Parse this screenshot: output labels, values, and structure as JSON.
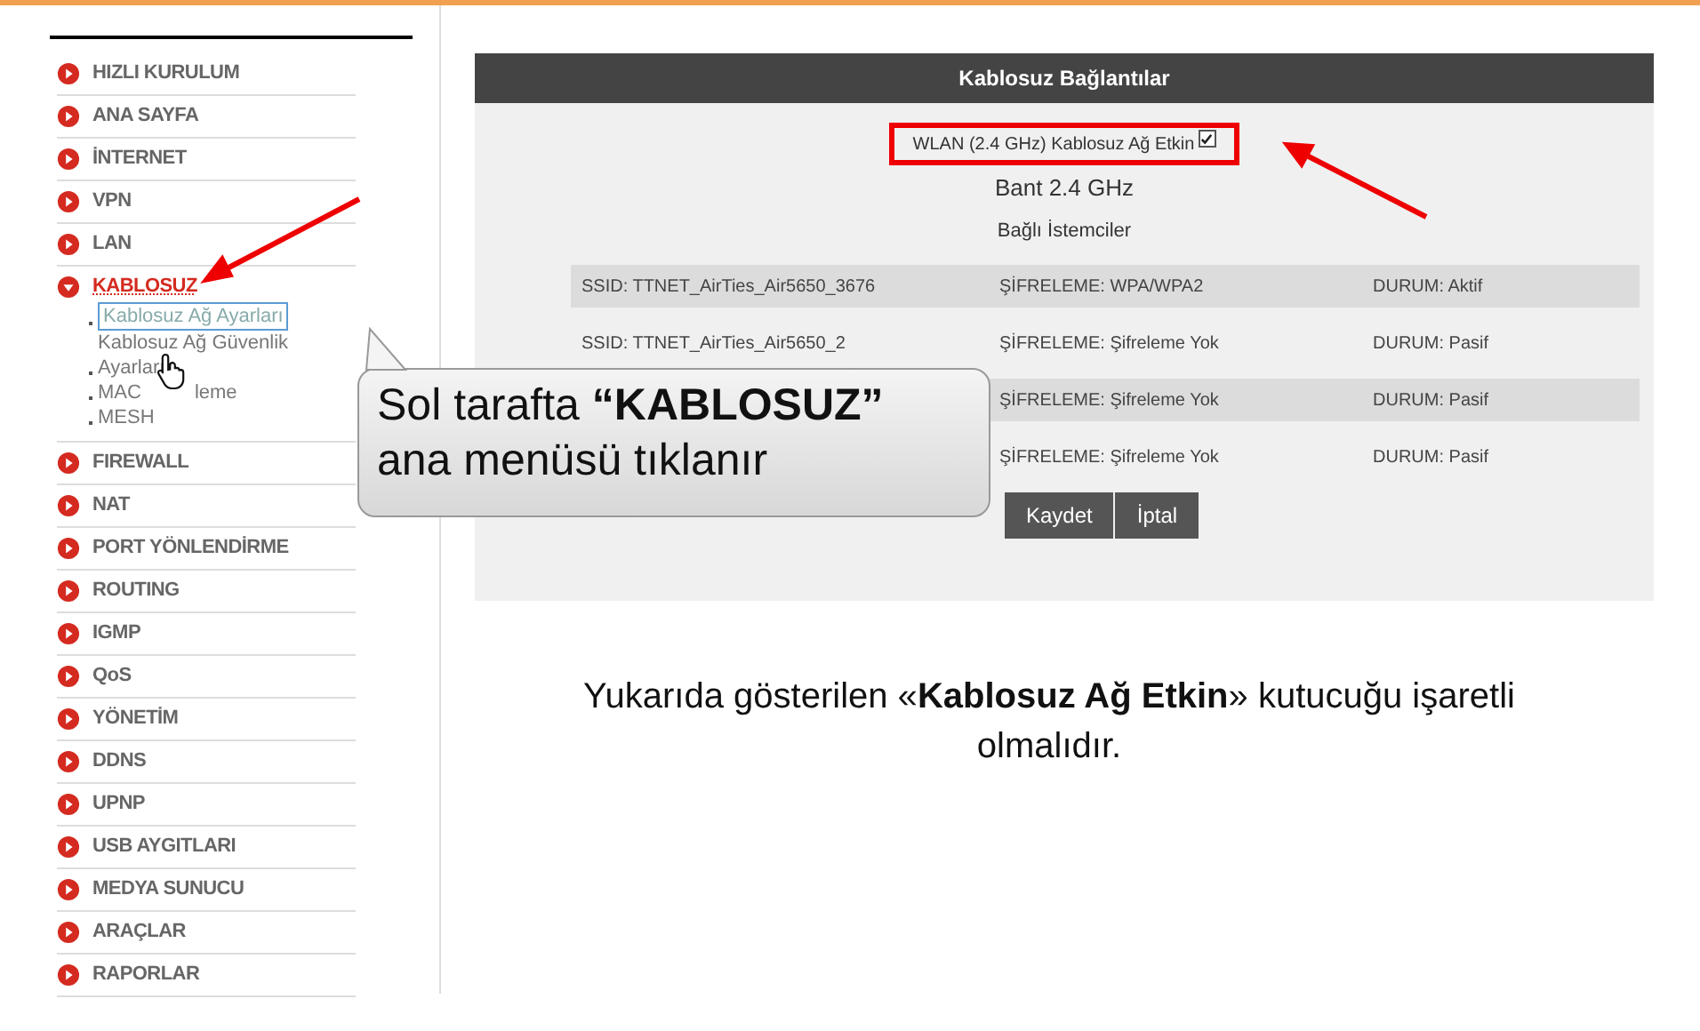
{
  "sidebar": {
    "items": [
      {
        "label": "HIZLI KURULUM",
        "selected": false,
        "expanded": false
      },
      {
        "label": "ANA SAYFA",
        "selected": false,
        "expanded": false
      },
      {
        "label": "İNTERNET",
        "selected": false,
        "expanded": false
      },
      {
        "label": "VPN",
        "selected": false,
        "expanded": false
      },
      {
        "label": "LAN",
        "selected": false,
        "expanded": false
      },
      {
        "label": "KABLOSUZ",
        "selected": true,
        "expanded": true,
        "children": [
          {
            "label": "Kablosuz Ağ Ayarları",
            "selected": true
          },
          {
            "label": "Kablosuz Ağ Güvenlik Ayarları",
            "selected": false
          },
          {
            "label": "MAC",
            "label_tail": "leme",
            "selected": false
          },
          {
            "label": "MESH",
            "selected": false
          }
        ]
      },
      {
        "label": "FIREWALL",
        "selected": false,
        "expanded": false
      },
      {
        "label": "NAT",
        "selected": false,
        "expanded": false
      },
      {
        "label": "PORT YÖNLENDİRME",
        "selected": false,
        "expanded": false
      },
      {
        "label": "ROUTING",
        "selected": false,
        "expanded": false
      },
      {
        "label": "IGMP",
        "selected": false,
        "expanded": false
      },
      {
        "label": "QoS",
        "selected": false,
        "expanded": false
      },
      {
        "label": "YÖNETİM",
        "selected": false,
        "expanded": false
      },
      {
        "label": "DDNS",
        "selected": false,
        "expanded": false
      },
      {
        "label": "UPNP",
        "selected": false,
        "expanded": false
      },
      {
        "label": "USB AYGITLARI",
        "selected": false,
        "expanded": false
      },
      {
        "label": "MEDYA SUNUCU",
        "selected": false,
        "expanded": false
      },
      {
        "label": "ARAÇLAR",
        "selected": false,
        "expanded": false
      },
      {
        "label": "RAPORLAR",
        "selected": false,
        "expanded": false
      }
    ]
  },
  "panel": {
    "title": "Kablosuz Bağlantılar",
    "wlan": {
      "label": "WLAN (2.4 GHz) Kablosuz Ağ Etkin",
      "checked": true
    },
    "band": "Bant 2.4 GHz",
    "clients_label": "Bağlı İstemciler",
    "rows": [
      {
        "ssid": "SSID: TTNET_AirTies_Air5650_3676",
        "encryption": "ŞİFRELEME: WPA/WPA2",
        "status": "DURUM: Aktif"
      },
      {
        "ssid": "SSID: TTNET_AirTies_Air5650_2",
        "encryption": "ŞİFRELEME: Şifreleme Yok",
        "status": "DURUM: Pasif"
      },
      {
        "encryption": "ŞİFRELEME: Şifreleme Yok",
        "status": "DURUM: Pasif"
      },
      {
        "encryption": "ŞİFRELEME: Şifreleme Yok",
        "status": "DURUM: Pasif"
      }
    ],
    "buttons": [
      "Kaydet",
      "İptal"
    ]
  },
  "callout": {
    "line1": "Sol tarafta **“KABLOSUZ”**",
    "line2": "ana menüsü tıklanır"
  },
  "caption": "Yukarıda gösterilen «**Kablosuz Ağ Etkin**» kutucuğu işaretli olmalıdır."
}
